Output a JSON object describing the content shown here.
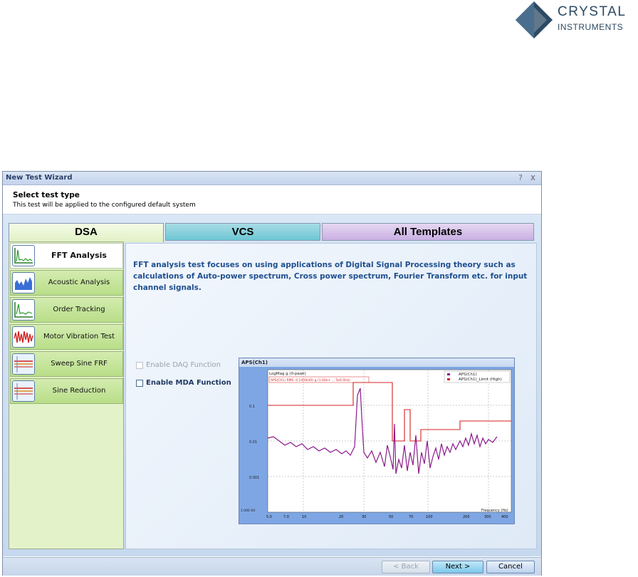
{
  "logo": {
    "line1": "CRYSTAL",
    "line2": "INSTRUMENTS"
  },
  "window": {
    "title": "New Test Wizard",
    "help": "?",
    "close": "x"
  },
  "header": {
    "title": "Select test type",
    "subtitle": "This test will be applied to the configured default system"
  },
  "tabs": [
    {
      "label": "DSA"
    },
    {
      "label": "VCS"
    },
    {
      "label": "All  Templates"
    }
  ],
  "test_types": [
    {
      "label": "FFT  Analysis",
      "icon": "fft-spectrum-icon",
      "selected": true
    },
    {
      "label": "Acoustic Analysis",
      "icon": "acoustic-bars-icon",
      "selected": false
    },
    {
      "label": "Order Tracking",
      "icon": "order-tracking-icon",
      "selected": false
    },
    {
      "label": "Motor Vibration Test",
      "icon": "motor-vibration-icon",
      "selected": false
    },
    {
      "label": "Sweep Sine FRF",
      "icon": "sweep-sine-icon",
      "selected": false
    },
    {
      "label": "Sine Reduction",
      "icon": "sine-reduction-icon",
      "selected": false
    }
  ],
  "description": "FFT analysis test focuses on using applications  of Digital Signal Processing theory such as calculations of Auto-power spectrum, Cross power spectrum, Fourier Transform etc. for input channel signals.",
  "options": {
    "daq": {
      "label": "Enable DAQ Function",
      "enabled": false
    },
    "mda": {
      "label": "Enable MDA Function",
      "enabled": true
    }
  },
  "preview": {
    "title": "APS(Ch1)",
    "ylabel": "LogMag g (0-peak)",
    "xlabel": "Frequency (Hz)",
    "legend": [
      "APS(Ch1)",
      "APS(Ch1)_Limit (High)"
    ],
    "cursor": "APS(Ch1) RMS: 0.1459(40) g  (1.00e+ ... 5e0.0Hz)",
    "y_ticks": [
      "0.1",
      "0.01",
      "0.001",
      "1.00E-04"
    ],
    "x_ticks": [
      "5.0",
      "7.0",
      "10",
      "20",
      "30",
      "50",
      "70",
      "100",
      "200",
      "300",
      "400"
    ],
    "colors": {
      "spectrum": "#8b1a8b",
      "limit": "#d42020"
    }
  },
  "footer": {
    "back": "< Back",
    "next": "Next >",
    "cancel": "Cancel"
  }
}
